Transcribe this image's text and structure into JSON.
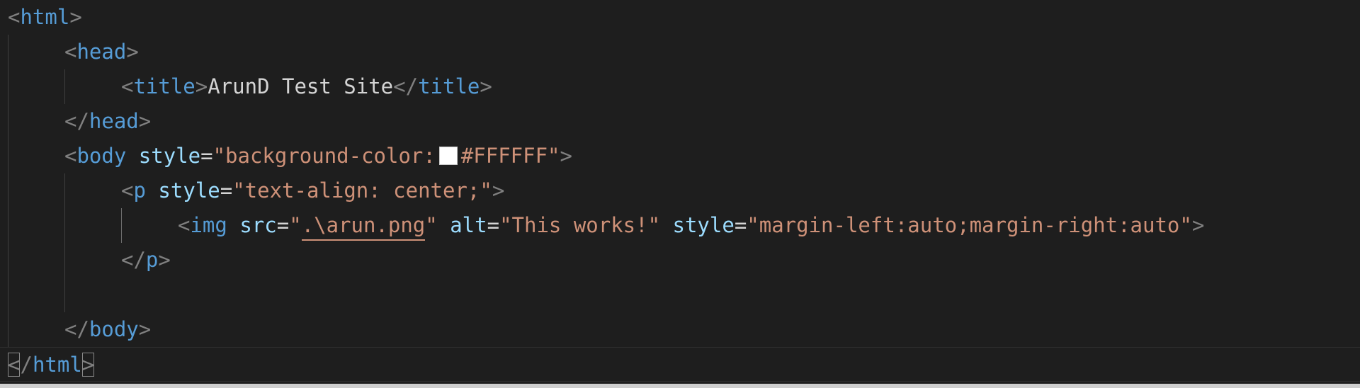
{
  "colors": {
    "background": "#1e1e1e",
    "tag": "#569cd6",
    "attribute": "#9cdcfe",
    "string": "#ce9178",
    "punctuation": "#808080",
    "text": "#d4d4d4",
    "swatch": "#ffffff"
  },
  "code": {
    "l1_tag": "html",
    "l2_tag": "head",
    "l3_tag": "title",
    "l3_text": "ArunD Test Site",
    "l3_close_tag": "title",
    "l4_tag": "head",
    "l5_tag": "body",
    "l5_attr": "style",
    "l5_val_open": "\"background-color:",
    "l5_val_close": "#FFFFFF\"",
    "l6_tag": "p",
    "l6_attr": "style",
    "l6_val": "\"text-align: center;\"",
    "l7_tag": "img",
    "l7_attr1": "src",
    "l7_q": "\"",
    "l7_src": ".\\arun.png",
    "l7_attr2": "alt",
    "l7_alt": "\"This works!\"",
    "l7_attr3": "style",
    "l7_style": "\"margin-left:auto;margin-right:auto\"",
    "l8_tag": "p",
    "l10_tag": "body",
    "l11_tag": "html"
  }
}
